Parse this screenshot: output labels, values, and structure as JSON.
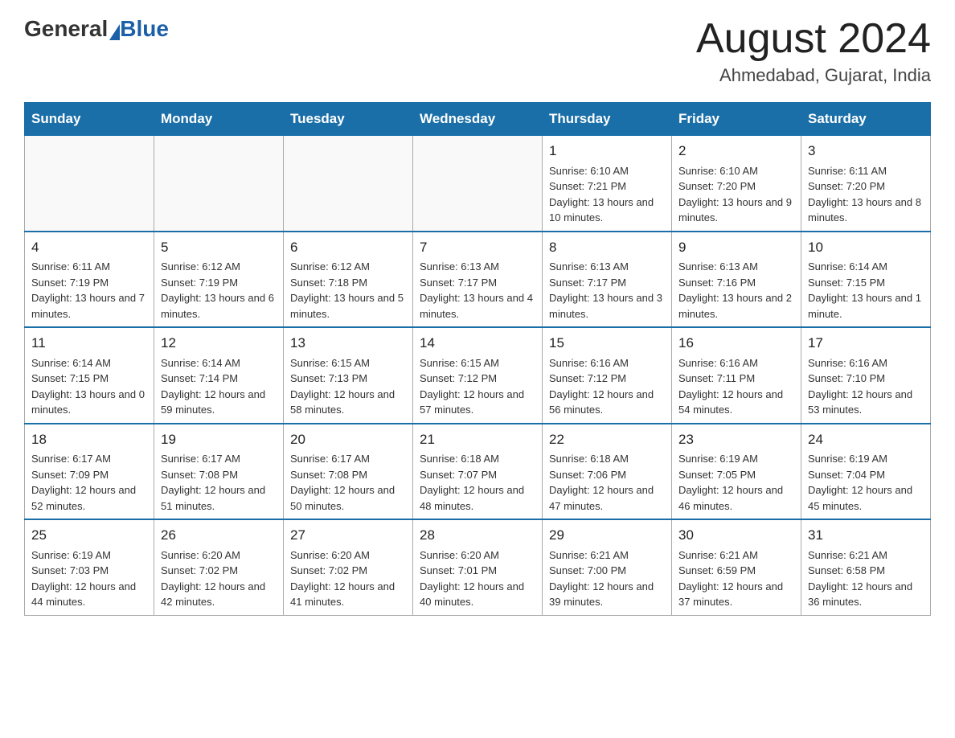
{
  "logo": {
    "text_general": "General",
    "text_blue": "Blue"
  },
  "header": {
    "title": "August 2024",
    "subtitle": "Ahmedabad, Gujarat, India"
  },
  "weekdays": [
    "Sunday",
    "Monday",
    "Tuesday",
    "Wednesday",
    "Thursday",
    "Friday",
    "Saturday"
  ],
  "weeks": [
    [
      {
        "day": "",
        "info": ""
      },
      {
        "day": "",
        "info": ""
      },
      {
        "day": "",
        "info": ""
      },
      {
        "day": "",
        "info": ""
      },
      {
        "day": "1",
        "info": "Sunrise: 6:10 AM\nSunset: 7:21 PM\nDaylight: 13 hours and 10 minutes."
      },
      {
        "day": "2",
        "info": "Sunrise: 6:10 AM\nSunset: 7:20 PM\nDaylight: 13 hours and 9 minutes."
      },
      {
        "day": "3",
        "info": "Sunrise: 6:11 AM\nSunset: 7:20 PM\nDaylight: 13 hours and 8 minutes."
      }
    ],
    [
      {
        "day": "4",
        "info": "Sunrise: 6:11 AM\nSunset: 7:19 PM\nDaylight: 13 hours and 7 minutes."
      },
      {
        "day": "5",
        "info": "Sunrise: 6:12 AM\nSunset: 7:19 PM\nDaylight: 13 hours and 6 minutes."
      },
      {
        "day": "6",
        "info": "Sunrise: 6:12 AM\nSunset: 7:18 PM\nDaylight: 13 hours and 5 minutes."
      },
      {
        "day": "7",
        "info": "Sunrise: 6:13 AM\nSunset: 7:17 PM\nDaylight: 13 hours and 4 minutes."
      },
      {
        "day": "8",
        "info": "Sunrise: 6:13 AM\nSunset: 7:17 PM\nDaylight: 13 hours and 3 minutes."
      },
      {
        "day": "9",
        "info": "Sunrise: 6:13 AM\nSunset: 7:16 PM\nDaylight: 13 hours and 2 minutes."
      },
      {
        "day": "10",
        "info": "Sunrise: 6:14 AM\nSunset: 7:15 PM\nDaylight: 13 hours and 1 minute."
      }
    ],
    [
      {
        "day": "11",
        "info": "Sunrise: 6:14 AM\nSunset: 7:15 PM\nDaylight: 13 hours and 0 minutes."
      },
      {
        "day": "12",
        "info": "Sunrise: 6:14 AM\nSunset: 7:14 PM\nDaylight: 12 hours and 59 minutes."
      },
      {
        "day": "13",
        "info": "Sunrise: 6:15 AM\nSunset: 7:13 PM\nDaylight: 12 hours and 58 minutes."
      },
      {
        "day": "14",
        "info": "Sunrise: 6:15 AM\nSunset: 7:12 PM\nDaylight: 12 hours and 57 minutes."
      },
      {
        "day": "15",
        "info": "Sunrise: 6:16 AM\nSunset: 7:12 PM\nDaylight: 12 hours and 56 minutes."
      },
      {
        "day": "16",
        "info": "Sunrise: 6:16 AM\nSunset: 7:11 PM\nDaylight: 12 hours and 54 minutes."
      },
      {
        "day": "17",
        "info": "Sunrise: 6:16 AM\nSunset: 7:10 PM\nDaylight: 12 hours and 53 minutes."
      }
    ],
    [
      {
        "day": "18",
        "info": "Sunrise: 6:17 AM\nSunset: 7:09 PM\nDaylight: 12 hours and 52 minutes."
      },
      {
        "day": "19",
        "info": "Sunrise: 6:17 AM\nSunset: 7:08 PM\nDaylight: 12 hours and 51 minutes."
      },
      {
        "day": "20",
        "info": "Sunrise: 6:17 AM\nSunset: 7:08 PM\nDaylight: 12 hours and 50 minutes."
      },
      {
        "day": "21",
        "info": "Sunrise: 6:18 AM\nSunset: 7:07 PM\nDaylight: 12 hours and 48 minutes."
      },
      {
        "day": "22",
        "info": "Sunrise: 6:18 AM\nSunset: 7:06 PM\nDaylight: 12 hours and 47 minutes."
      },
      {
        "day": "23",
        "info": "Sunrise: 6:19 AM\nSunset: 7:05 PM\nDaylight: 12 hours and 46 minutes."
      },
      {
        "day": "24",
        "info": "Sunrise: 6:19 AM\nSunset: 7:04 PM\nDaylight: 12 hours and 45 minutes."
      }
    ],
    [
      {
        "day": "25",
        "info": "Sunrise: 6:19 AM\nSunset: 7:03 PM\nDaylight: 12 hours and 44 minutes."
      },
      {
        "day": "26",
        "info": "Sunrise: 6:20 AM\nSunset: 7:02 PM\nDaylight: 12 hours and 42 minutes."
      },
      {
        "day": "27",
        "info": "Sunrise: 6:20 AM\nSunset: 7:02 PM\nDaylight: 12 hours and 41 minutes."
      },
      {
        "day": "28",
        "info": "Sunrise: 6:20 AM\nSunset: 7:01 PM\nDaylight: 12 hours and 40 minutes."
      },
      {
        "day": "29",
        "info": "Sunrise: 6:21 AM\nSunset: 7:00 PM\nDaylight: 12 hours and 39 minutes."
      },
      {
        "day": "30",
        "info": "Sunrise: 6:21 AM\nSunset: 6:59 PM\nDaylight: 12 hours and 37 minutes."
      },
      {
        "day": "31",
        "info": "Sunrise: 6:21 AM\nSunset: 6:58 PM\nDaylight: 12 hours and 36 minutes."
      }
    ]
  ]
}
